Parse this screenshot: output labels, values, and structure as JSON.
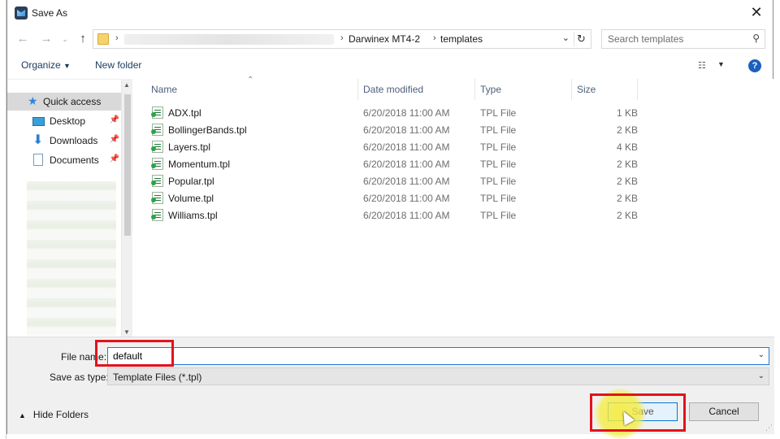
{
  "window": {
    "title": "Save As",
    "close_icon": "close-icon",
    "app_icon": "app-icon"
  },
  "nav": {
    "back_icon": "arrow-left-icon",
    "forward_icon": "arrow-right-icon",
    "recent_icon": "chevron-down-icon",
    "up_icon": "arrow-up-icon",
    "breadcrumb": [
      "Darwinex MT4-2",
      "templates"
    ],
    "refresh_icon": "refresh-icon",
    "search_placeholder": "Search templates"
  },
  "toolbar": {
    "organize_label": "Organize",
    "new_folder_label": "New folder",
    "view_icon": "view-options-icon",
    "help_icon": "help-icon"
  },
  "sidebar": {
    "items": [
      {
        "label": "Quick access",
        "icon": "star-icon",
        "selected": true
      },
      {
        "label": "Desktop",
        "icon": "desktop-icon",
        "pinned": true
      },
      {
        "label": "Downloads",
        "icon": "download-arrow-icon",
        "pinned": true
      },
      {
        "label": "Documents",
        "icon": "document-icon",
        "pinned": true
      }
    ]
  },
  "columns": {
    "name": "Name",
    "date": "Date modified",
    "type": "Type",
    "size": "Size"
  },
  "files": [
    {
      "name": "ADX.tpl",
      "date": "6/20/2018 11:00 AM",
      "type": "TPL File",
      "size": "1 KB"
    },
    {
      "name": "BollingerBands.tpl",
      "date": "6/20/2018 11:00 AM",
      "type": "TPL File",
      "size": "2 KB"
    },
    {
      "name": "Layers.tpl",
      "date": "6/20/2018 11:00 AM",
      "type": "TPL File",
      "size": "4 KB"
    },
    {
      "name": "Momentum.tpl",
      "date": "6/20/2018 11:00 AM",
      "type": "TPL File",
      "size": "2 KB"
    },
    {
      "name": "Popular.tpl",
      "date": "6/20/2018 11:00 AM",
      "type": "TPL File",
      "size": "2 KB"
    },
    {
      "name": "Volume.tpl",
      "date": "6/20/2018 11:00 AM",
      "type": "TPL File",
      "size": "2 KB"
    },
    {
      "name": "Williams.tpl",
      "date": "6/20/2018 11:00 AM",
      "type": "TPL File",
      "size": "2 KB"
    }
  ],
  "form": {
    "file_name_label": "File name:",
    "file_name_value": "default",
    "save_type_label": "Save as type:",
    "save_type_value": "Template Files (*.tpl)"
  },
  "footer": {
    "hide_folders_label": "Hide Folders",
    "save_label": "Save",
    "cancel_label": "Cancel"
  },
  "colors": {
    "accent": "#0078d7",
    "highlight_box": "#e3121b",
    "cursor_highlight": "#f6ec3c",
    "selected_nav": "#d9d9d9"
  }
}
